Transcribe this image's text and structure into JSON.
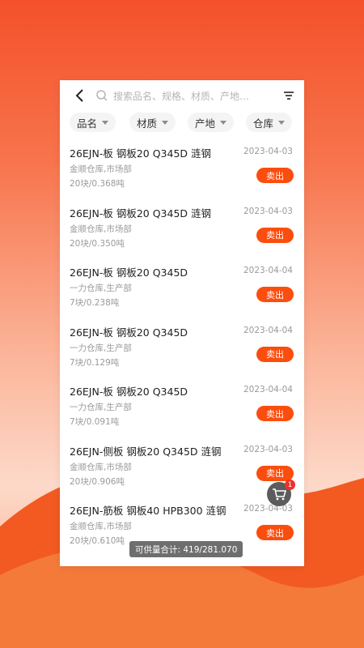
{
  "search": {
    "placeholder": "搜索品名、规格、材质、产地…"
  },
  "filters": [
    {
      "label": "品名"
    },
    {
      "label": "材质"
    },
    {
      "label": "产地"
    },
    {
      "label": "仓库"
    }
  ],
  "items": [
    {
      "title": "26EJN-板 钢板20 Q345D 涟钢",
      "date": "2023-04-03",
      "location": "金顺仓库,市场部",
      "quantity": "20块/0.368吨",
      "action": "卖出"
    },
    {
      "title": "26EJN-板 钢板20 Q345D 涟钢",
      "date": "2023-04-03",
      "location": "金顺仓库,市场部",
      "quantity": "20块/0.350吨",
      "action": "卖出"
    },
    {
      "title": "26EJN-板 钢板20 Q345D",
      "date": "2023-04-04",
      "location": "一力仓库,生产部",
      "quantity": "7块/0.238吨",
      "action": "卖出"
    },
    {
      "title": "26EJN-板 钢板20 Q345D",
      "date": "2023-04-04",
      "location": "一力仓库,生产部",
      "quantity": "7块/0.129吨",
      "action": "卖出"
    },
    {
      "title": "26EJN-板 钢板20 Q345D",
      "date": "2023-04-04",
      "location": "一力仓库,生产部",
      "quantity": "7块/0.091吨",
      "action": "卖出"
    },
    {
      "title": "26EJN-侧板 钢板20 Q345D 涟钢",
      "date": "2023-04-03",
      "location": "金顺仓库,市场部",
      "quantity": "20块/0.906吨",
      "action": "卖出"
    },
    {
      "title": "26EJN-筋板 钢板40 HPB300 涟钢",
      "date": "2023-04-03",
      "location": "金顺仓库,市场部",
      "quantity": "20块/0.610吨",
      "action": "卖出"
    }
  ],
  "cart": {
    "badge": "1"
  },
  "supply_total": "可供量合计: 419/281.070",
  "colors": {
    "accent": "#fb4d0e",
    "background_top": "#f4512a"
  }
}
